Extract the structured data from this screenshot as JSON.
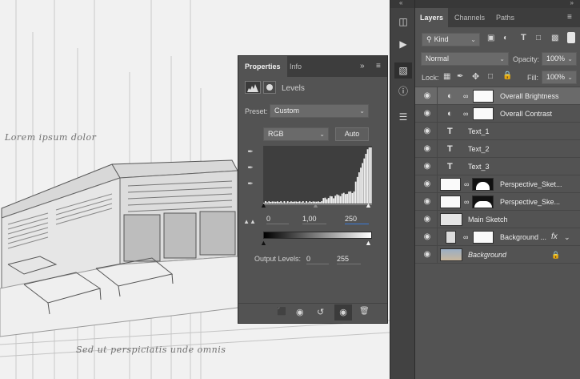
{
  "canvas": {
    "text_top": "Lorem ipsum dolor",
    "text_bottom": "Sed ut perspiciatis unde omnis"
  },
  "properties": {
    "tabs": [
      "Properties",
      "Info"
    ],
    "adjustment": "Levels",
    "preset_label": "Preset:",
    "preset_value": "Custom",
    "channel": "RGB",
    "auto_label": "Auto",
    "input_levels": {
      "black": "0",
      "gamma": "1,00",
      "white": "250"
    },
    "output_label": "Output Levels:",
    "output_levels": {
      "black": "0",
      "white": "255"
    },
    "menu_icon": "double-chevron-right-icon"
  },
  "histogram": {
    "type": "histogram",
    "bins": 64,
    "range": [
      0,
      255
    ],
    "peak_near": 245
  },
  "layers_panel": {
    "tabs": [
      "Layers",
      "Channels",
      "Paths"
    ],
    "filter_kind": "Kind",
    "blend_mode": "Normal",
    "opacity_label": "Opacity:",
    "opacity_value": "100%",
    "lock_label": "Lock:",
    "fill_label": "Fill:",
    "fill_value": "100%",
    "layers": [
      {
        "name": "Overall Brightness",
        "kind": "adjustment",
        "selected": true
      },
      {
        "name": "Overall Contrast",
        "kind": "adjustment",
        "selected": false
      },
      {
        "name": "Text_1",
        "kind": "text",
        "selected": false
      },
      {
        "name": "Text_2",
        "kind": "text",
        "selected": false
      },
      {
        "name": "Text_3",
        "kind": "text",
        "selected": false
      },
      {
        "name": "Perspective_Sket...",
        "kind": "masked-image",
        "selected": false
      },
      {
        "name": "Perspective_Ske...",
        "kind": "masked-image",
        "selected": false
      },
      {
        "name": "Main Sketch",
        "kind": "image",
        "selected": false
      },
      {
        "name": "Background ...",
        "kind": "fill-fx",
        "selected": false
      },
      {
        "name": "Background",
        "kind": "background",
        "selected": false
      }
    ]
  },
  "colors": {
    "panel": "#535353",
    "panel_dark": "#3d3d3d",
    "selected_row": "#6a6a6a",
    "canvas": "#f1f1f1"
  }
}
